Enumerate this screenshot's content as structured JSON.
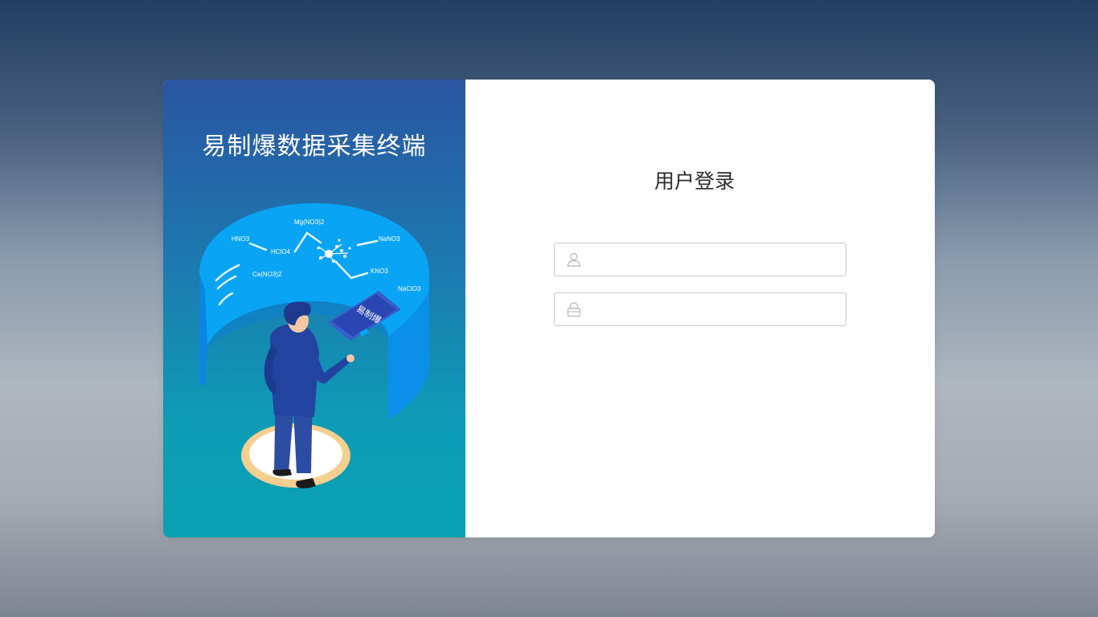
{
  "app": {
    "title": "易制爆数据采集终端"
  },
  "illustration": {
    "chemicals": [
      "Mg(NO3)2",
      "HNO3",
      "HClO4",
      "NaNO3",
      "Ca(NO3)2",
      "KNO3",
      "NaClO3"
    ],
    "tablet_label": "易制爆"
  },
  "login": {
    "title": "用户登录",
    "username": {
      "icon": "user-icon",
      "value": "",
      "placeholder": ""
    },
    "password": {
      "icon": "lock-icon",
      "value": "",
      "placeholder": ""
    }
  },
  "colors": {
    "left_panel_top": "#2a55a2",
    "left_panel_bottom": "#09a1b3",
    "accent_blue": "#0aa4f4",
    "field_border": "#c9c9c9"
  }
}
